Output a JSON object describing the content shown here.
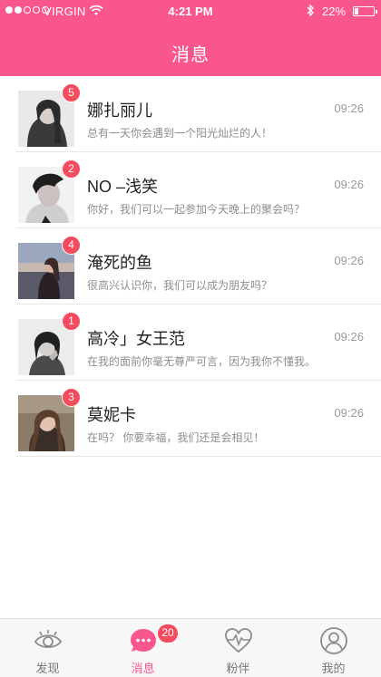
{
  "status_bar": {
    "carrier": "VIRGIN",
    "time": "4:21 PM",
    "battery": "22%",
    "battery_level": 0.22,
    "signal_bars": 2
  },
  "nav": {
    "title": "消息"
  },
  "colors": {
    "brand": "#f9568f",
    "badge": "#f44b5e"
  },
  "conversations": [
    {
      "name": "娜扎丽儿",
      "preview": "总有一天你会遇到一个阳光灿烂的人！",
      "time": "09:26",
      "unread": "5"
    },
    {
      "name": "NO –浅笑",
      "preview": "你好，我们可以一起参加今天晚上的聚会吗？",
      "time": "09:26",
      "unread": "2"
    },
    {
      "name": "淹死的鱼",
      "preview": "很高兴认识你，我们可以成为朋友吗？",
      "time": "09:26",
      "unread": "4"
    },
    {
      "name": "高冷」女王范",
      "preview": "在我的面前你毫无尊严可言，因为我你不懂我。",
      "time": "09:26",
      "unread": "1"
    },
    {
      "name": "莫妮卡",
      "preview": "在吗？ 你要幸福，我们还是会相见！",
      "time": "09:26",
      "unread": "3"
    }
  ],
  "tabs": [
    {
      "label": "发现",
      "icon": "eye-icon"
    },
    {
      "label": "消息",
      "icon": "chat-bubble-icon",
      "badge": "20",
      "active": true
    },
    {
      "label": "粉伴",
      "icon": "heart-pulse-icon"
    },
    {
      "label": "我的",
      "icon": "user-profile-icon"
    }
  ]
}
